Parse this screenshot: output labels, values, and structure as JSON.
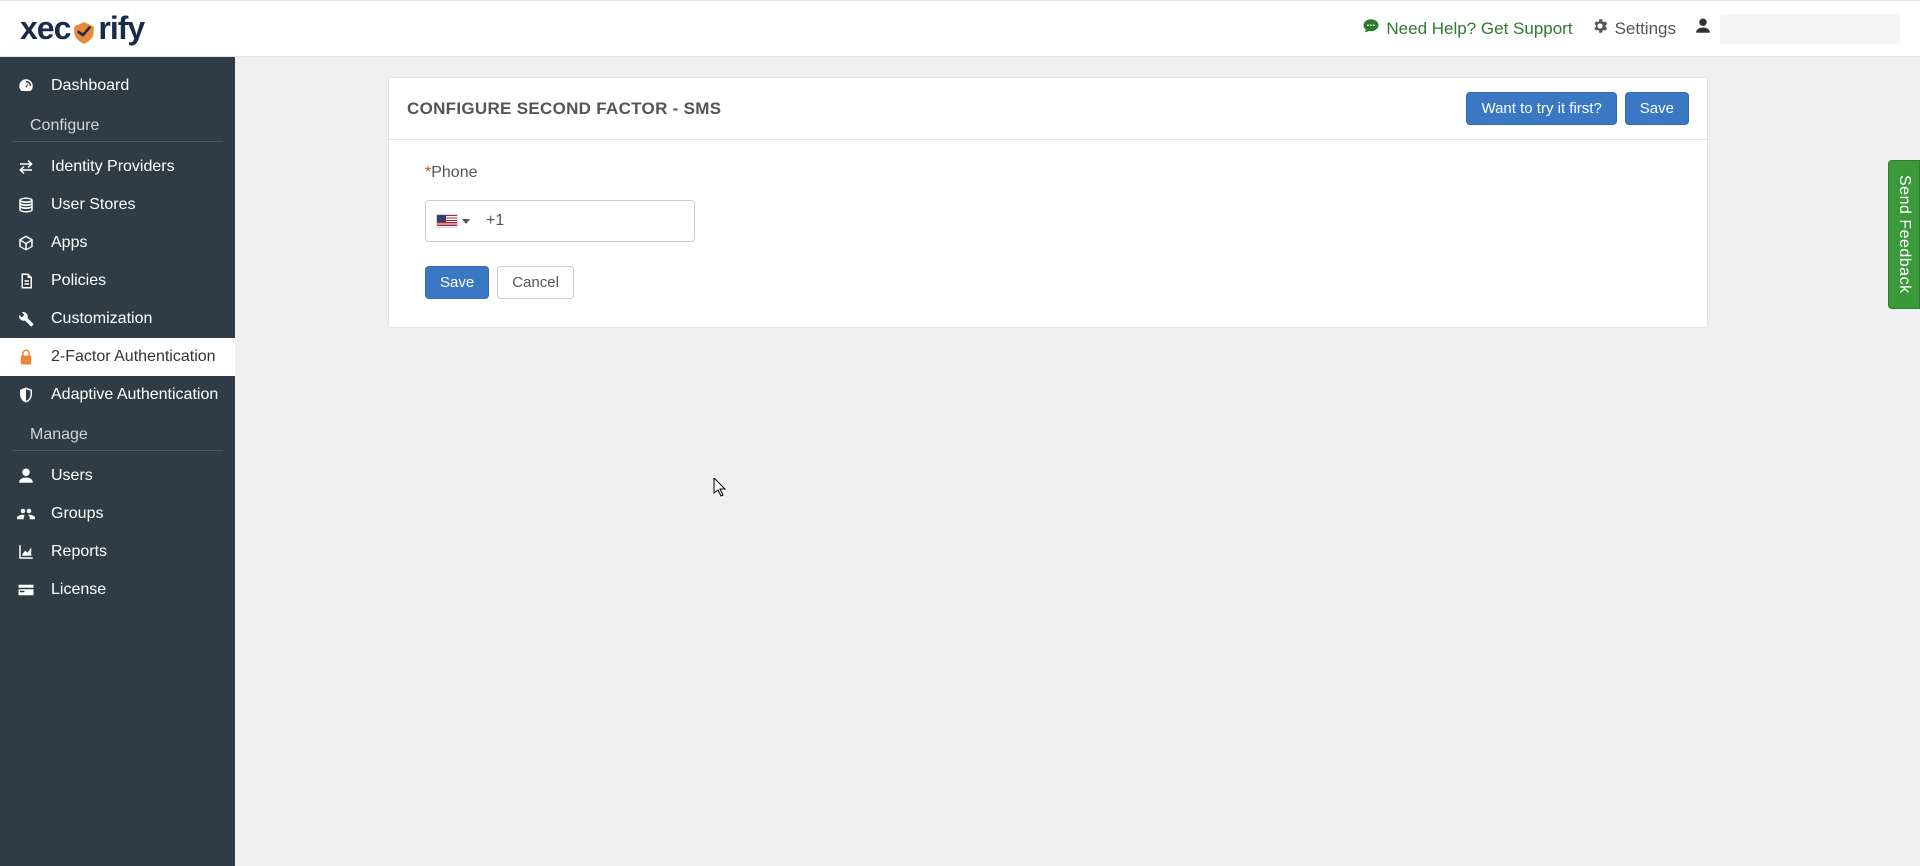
{
  "topbar": {
    "logo_part1": "xec",
    "logo_part2": "rify",
    "help_label": "Need Help? Get Support",
    "settings_label": "Settings"
  },
  "sidebar": {
    "items": [
      {
        "label": "Dashboard"
      }
    ],
    "section_configure": "Configure",
    "configure_items": [
      {
        "label": "Identity Providers"
      },
      {
        "label": "User Stores"
      },
      {
        "label": "Apps"
      },
      {
        "label": "Policies"
      },
      {
        "label": "Customization"
      },
      {
        "label": "2-Factor Authentication"
      },
      {
        "label": "Adaptive Authentication"
      }
    ],
    "section_manage": "Manage",
    "manage_items": [
      {
        "label": "Users"
      },
      {
        "label": "Groups"
      },
      {
        "label": "Reports"
      },
      {
        "label": "License"
      }
    ]
  },
  "panel": {
    "title": "CONFIGURE SECOND FACTOR - SMS",
    "try_label": "Want to try it first?",
    "save_label": "Save"
  },
  "form": {
    "phone_label": "Phone",
    "required_mark": "*",
    "phone_prefix": "+1",
    "phone_value": "",
    "save_label": "Save",
    "cancel_label": "Cancel"
  },
  "feedback": {
    "label": "Send Feedback"
  }
}
